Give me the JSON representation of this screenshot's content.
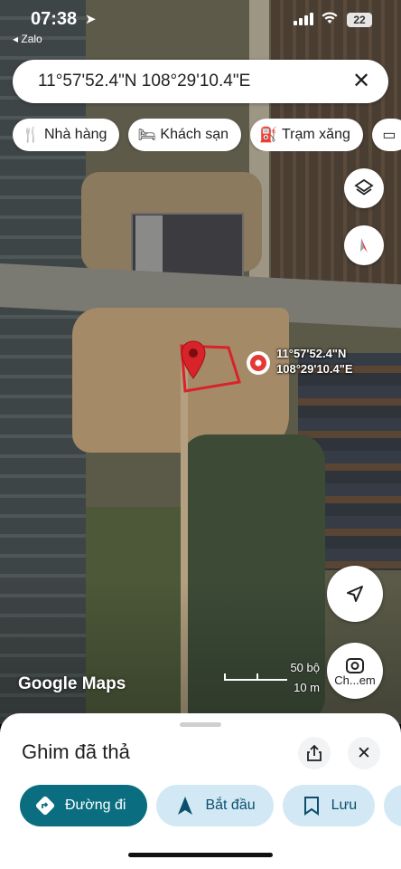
{
  "status_bar": {
    "time": "07:38",
    "back_app": "◂ Zalo",
    "battery": "22"
  },
  "search": {
    "query": "11°57'52.4\"N 108°29'10.4\"E",
    "close_icon": "close-icon"
  },
  "chips": [
    {
      "label": "Nhà hàng",
      "icon": "restaurant-icon"
    },
    {
      "label": "Khách sạn",
      "icon": "hotel-icon"
    },
    {
      "label": "Trạm xăng",
      "icon": "gas-station-icon"
    }
  ],
  "map": {
    "marker_label_line1": "11°57'52.4\"N",
    "marker_label_line2": "108°29'10.4\"E",
    "logo": "Google Maps",
    "scale_ft": "50 bộ",
    "scale_m": "10 m",
    "lens_label": "Ch...em",
    "accent_red": "#d93025"
  },
  "sheet": {
    "title": "Ghim đã thả",
    "actions": [
      {
        "label": "Đường đi",
        "icon": "directions-icon",
        "primary": true
      },
      {
        "label": "Bắt đầu",
        "icon": "navigation-arrow-icon"
      },
      {
        "label": "Lưu",
        "icon": "bookmark-icon"
      }
    ],
    "primary_color": "#0b6e80",
    "secondary_color": "#d2e9f5"
  }
}
